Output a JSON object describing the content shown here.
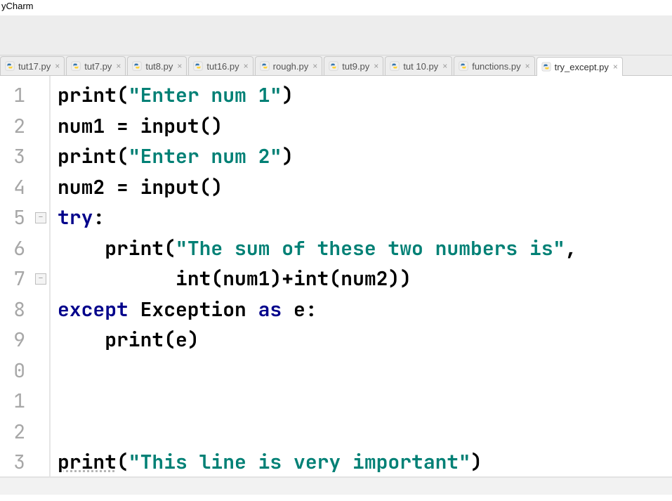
{
  "app": {
    "title": "yCharm"
  },
  "tabs": [
    {
      "label": "tut17.py",
      "active": false
    },
    {
      "label": "tut7.py",
      "active": false
    },
    {
      "label": "tut8.py",
      "active": false
    },
    {
      "label": "tut16.py",
      "active": false
    },
    {
      "label": "rough.py",
      "active": false
    },
    {
      "label": "tut9.py",
      "active": false
    },
    {
      "label": "tut 10.py",
      "active": false
    },
    {
      "label": "functions.py",
      "active": false
    },
    {
      "label": "try_except.py",
      "active": true
    }
  ],
  "editor": {
    "line_numbers": [
      "1",
      "2",
      "3",
      "4",
      "5",
      "6",
      "7",
      "8",
      "9",
      "0",
      "1",
      "2",
      "3"
    ],
    "current_line_index": 11,
    "lines": [
      [
        {
          "t": "print",
          "c": "fn"
        },
        {
          "t": "(",
          "c": "par"
        },
        {
          "t": "\"Enter num 1\"",
          "c": "str"
        },
        {
          "t": ")",
          "c": "par"
        }
      ],
      [
        {
          "t": "num1 ",
          "c": "fn"
        },
        {
          "t": "= ",
          "c": "op"
        },
        {
          "t": "input",
          "c": "fn"
        },
        {
          "t": "()",
          "c": "par"
        }
      ],
      [
        {
          "t": "print",
          "c": "fn"
        },
        {
          "t": "(",
          "c": "par"
        },
        {
          "t": "\"Enter num 2\"",
          "c": "str"
        },
        {
          "t": ")",
          "c": "par"
        }
      ],
      [
        {
          "t": "num2 ",
          "c": "fn"
        },
        {
          "t": "= ",
          "c": "op"
        },
        {
          "t": "input",
          "c": "fn"
        },
        {
          "t": "()",
          "c": "par"
        }
      ],
      [
        {
          "t": "try",
          "c": "kw"
        },
        {
          "t": ":",
          "c": "op"
        }
      ],
      [
        {
          "t": "    ",
          "c": "fn"
        },
        {
          "t": "print",
          "c": "fn"
        },
        {
          "t": "(",
          "c": "par"
        },
        {
          "t": "\"The sum of these two numbers is\"",
          "c": "str"
        },
        {
          "t": ",",
          "c": "op"
        }
      ],
      [
        {
          "t": "          ",
          "c": "fn"
        },
        {
          "t": "int",
          "c": "fn"
        },
        {
          "t": "(",
          "c": "par"
        },
        {
          "t": "num1",
          "c": "fn"
        },
        {
          "t": ")",
          "c": "par"
        },
        {
          "t": "+",
          "c": "op"
        },
        {
          "t": "int",
          "c": "fn"
        },
        {
          "t": "(",
          "c": "par"
        },
        {
          "t": "num2",
          "c": "fn"
        },
        {
          "t": "))",
          "c": "par"
        }
      ],
      [
        {
          "t": "except ",
          "c": "kw"
        },
        {
          "t": "Exception ",
          "c": "fn"
        },
        {
          "t": "as ",
          "c": "kw"
        },
        {
          "t": "e",
          "c": "fn"
        },
        {
          "t": ":",
          "c": "op"
        }
      ],
      [
        {
          "t": "    ",
          "c": "fn"
        },
        {
          "t": "print",
          "c": "fn"
        },
        {
          "t": "(",
          "c": "par"
        },
        {
          "t": "e",
          "c": "fn"
        },
        {
          "t": ")",
          "c": "par"
        }
      ],
      [],
      [],
      [],
      [
        {
          "t": "print",
          "c": "fn und"
        },
        {
          "t": "(",
          "c": "par"
        },
        {
          "t": "\"This line is very important\"",
          "c": "str"
        },
        {
          "t": ")",
          "c": "par"
        }
      ]
    ],
    "fold_markers": [
      {
        "line_index": 4
      },
      {
        "line_index": 6
      }
    ]
  },
  "colors": {
    "keyword": "#00008b",
    "string": "#008075",
    "gutter": "#a7a7a7",
    "current_line": "#fcfadf"
  }
}
